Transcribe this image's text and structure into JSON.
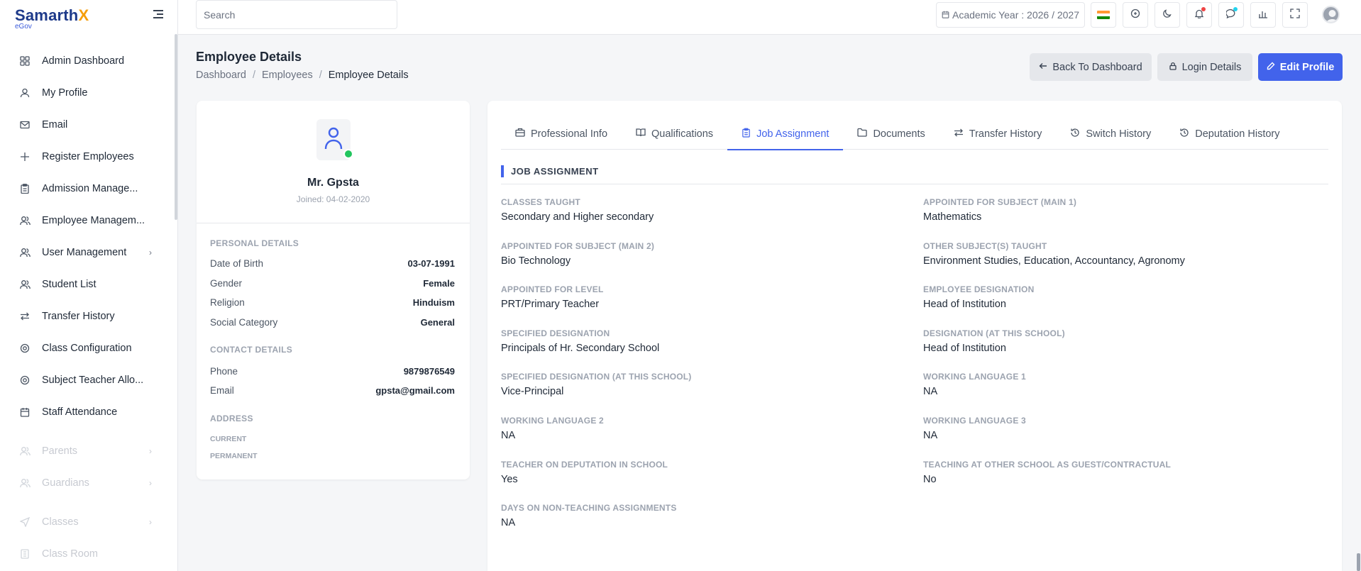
{
  "sidebar": {
    "logo": {
      "brand": "Samarth",
      "brand_x": "X",
      "sub": "eGov"
    },
    "items": [
      {
        "label": "Admin Dashboard",
        "icon": "dashboard-icon"
      },
      {
        "label": "My Profile",
        "icon": "user-icon"
      },
      {
        "label": "Email",
        "icon": "mail-icon"
      },
      {
        "label": "Register Employees",
        "icon": "plus-icon"
      },
      {
        "label": "Admission Manage...",
        "icon": "clipboard-icon"
      },
      {
        "label": "Employee Managem...",
        "icon": "users-icon"
      },
      {
        "label": "User Management",
        "icon": "users-icon",
        "chevron": true
      },
      {
        "label": "Student List",
        "icon": "users-icon"
      },
      {
        "label": "Transfer History",
        "icon": "transfer-icon"
      },
      {
        "label": "Class Configuration",
        "icon": "settings-icon"
      },
      {
        "label": "Subject Teacher Allo...",
        "icon": "settings-icon"
      },
      {
        "label": "Staff Attendance",
        "icon": "calendar-icon"
      },
      {
        "label": "Parents",
        "icon": "users-icon",
        "chevron": true,
        "disabled": true
      },
      {
        "label": "Guardians",
        "icon": "users-icon",
        "chevron": true,
        "disabled": true
      },
      {
        "label": "Classes",
        "icon": "send-icon",
        "chevron": true,
        "disabled": true
      },
      {
        "label": "Class Room",
        "icon": "building-icon",
        "disabled": true
      }
    ]
  },
  "topbar": {
    "search_placeholder": "Search",
    "academic_year": "Academic Year : 2026 / 2027"
  },
  "page": {
    "title": "Employee Details",
    "breadcrumb": [
      "Dashboard",
      "Employees",
      "Employee Details"
    ],
    "buttons": {
      "back": "Back To Dashboard",
      "login": "Login Details",
      "edit": "Edit Profile"
    }
  },
  "profile": {
    "name": "Mr. Gpsta",
    "joined": "Joined: 04-02-2020",
    "personal_heading": "PERSONAL DETAILS",
    "personal": [
      {
        "label": "Date of Birth",
        "value": "03-07-1991"
      },
      {
        "label": "Gender",
        "value": "Female"
      },
      {
        "label": "Religion",
        "value": "Hinduism"
      },
      {
        "label": "Social Category",
        "value": "General"
      }
    ],
    "contact_heading": "CONTACT DETAILS",
    "contact": [
      {
        "label": "Phone",
        "value": "9879876549"
      },
      {
        "label": "Email",
        "value": "gpsta@gmail.com"
      }
    ],
    "address_heading": "ADDRESS",
    "address_current": "CURRENT",
    "address_permanent": "PERMANENT"
  },
  "tabs": [
    {
      "label": "Professional Info",
      "icon": "briefcase-icon"
    },
    {
      "label": "Qualifications",
      "icon": "book-icon"
    },
    {
      "label": "Job Assignment",
      "icon": "clipboard-icon",
      "active": true
    },
    {
      "label": "Documents",
      "icon": "folder-icon"
    },
    {
      "label": "Transfer History",
      "icon": "transfer-icon"
    },
    {
      "label": "Switch History",
      "icon": "history-icon"
    },
    {
      "label": "Deputation History",
      "icon": "history-icon"
    }
  ],
  "job_assignment": {
    "heading": "JOB ASSIGNMENT",
    "fields": [
      {
        "label": "CLASSES TAUGHT",
        "value": "Secondary and Higher secondary"
      },
      {
        "label": "APPOINTED FOR SUBJECT (MAIN 1)",
        "value": "Mathematics"
      },
      {
        "label": "APPOINTED FOR SUBJECT (MAIN 2)",
        "value": "Bio Technology"
      },
      {
        "label": "OTHER SUBJECT(S) TAUGHT",
        "value": "Environment Studies, Education, Accountancy, Agronomy"
      },
      {
        "label": "APPOINTED FOR LEVEL",
        "value": "PRT/Primary Teacher"
      },
      {
        "label": "EMPLOYEE DESIGNATION",
        "value": "Head of Institution"
      },
      {
        "label": "SPECIFIED DESIGNATION",
        "value": "Principals of Hr. Secondary School"
      },
      {
        "label": "DESIGNATION (AT THIS SCHOOL)",
        "value": "Head of Institution"
      },
      {
        "label": "SPECIFIED DESIGNATION (AT THIS SCHOOL)",
        "value": "Vice-Principal"
      },
      {
        "label": "WORKING LANGUAGE 1",
        "value": "NA"
      },
      {
        "label": "WORKING LANGUAGE 2",
        "value": "NA"
      },
      {
        "label": "WORKING LANGUAGE 3",
        "value": "NA"
      },
      {
        "label": "TEACHER ON DEPUTATION IN SCHOOL",
        "value": "Yes"
      },
      {
        "label": "TEACHING AT OTHER SCHOOL AS GUEST/CONTRACTUAL",
        "value": "No"
      },
      {
        "label": "DAYS ON NON-TEACHING ASSIGNMENTS",
        "value": "NA"
      }
    ]
  },
  "colors": {
    "accent": "#4263eb",
    "brand": "#1e3a8a",
    "brand_x": "#f59e0b",
    "online": "#22c55e"
  }
}
